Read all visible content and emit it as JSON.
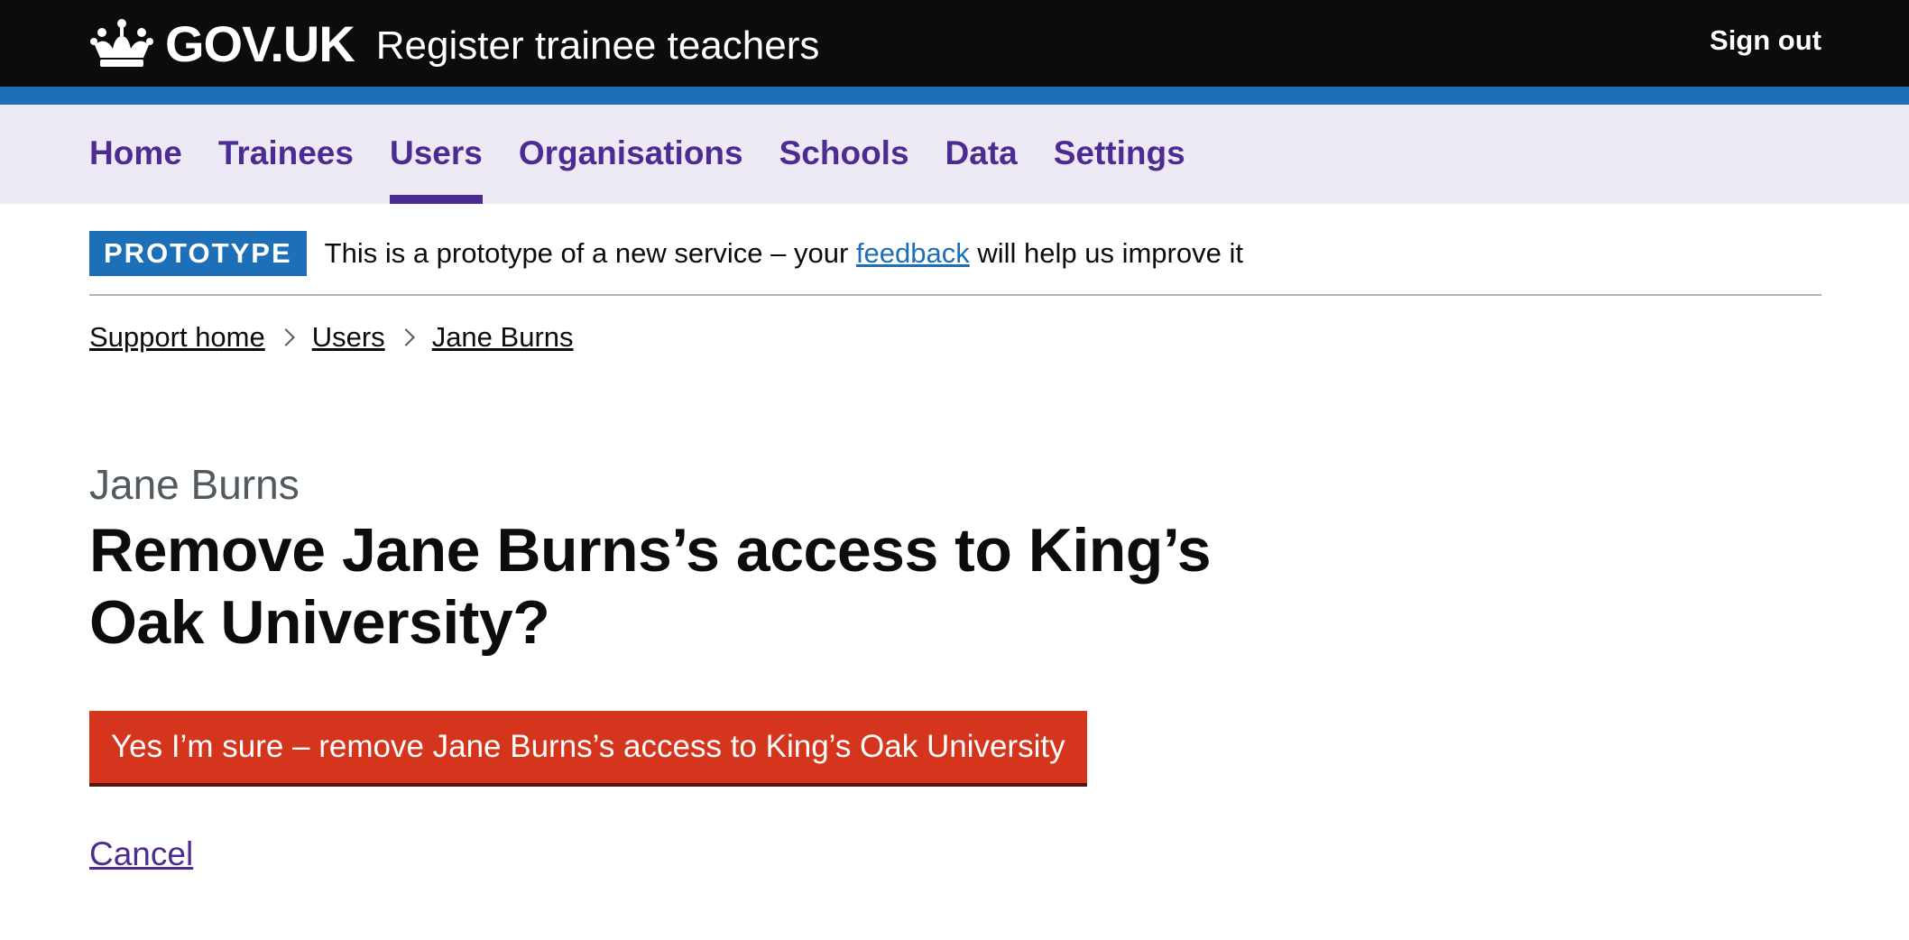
{
  "header": {
    "logo_text": "GOV.UK",
    "logo_icon": "crown-icon",
    "service_name": "Register trainee teachers",
    "sign_out": "Sign out"
  },
  "nav": {
    "items": [
      {
        "label": "Home",
        "active": false
      },
      {
        "label": "Trainees",
        "active": false
      },
      {
        "label": "Users",
        "active": true
      },
      {
        "label": "Organisations",
        "active": false
      },
      {
        "label": "Schools",
        "active": false
      },
      {
        "label": "Data",
        "active": false
      },
      {
        "label": "Settings",
        "active": false
      }
    ]
  },
  "phase_banner": {
    "tag": "PROTOTYPE",
    "text_before": "This is a prototype of a new service – your ",
    "link": "feedback",
    "text_after": " will help us improve it"
  },
  "breadcrumbs": [
    {
      "label": "Support home"
    },
    {
      "label": "Users"
    },
    {
      "label": "Jane Burns"
    }
  ],
  "page": {
    "caption": "Jane Burns",
    "heading": "Remove Jane Burns’s access to King’s Oak University?",
    "confirm_button": "Yes I’m sure – remove Jane Burns’s access to King’s Oak University",
    "cancel_link": "Cancel"
  },
  "colors": {
    "header_bg": "#0b0c0c",
    "blue_bar": "#1d70b8",
    "nav_bg": "#edeaf5",
    "nav_link": "#4c2c92",
    "warning": "#d4351c"
  }
}
